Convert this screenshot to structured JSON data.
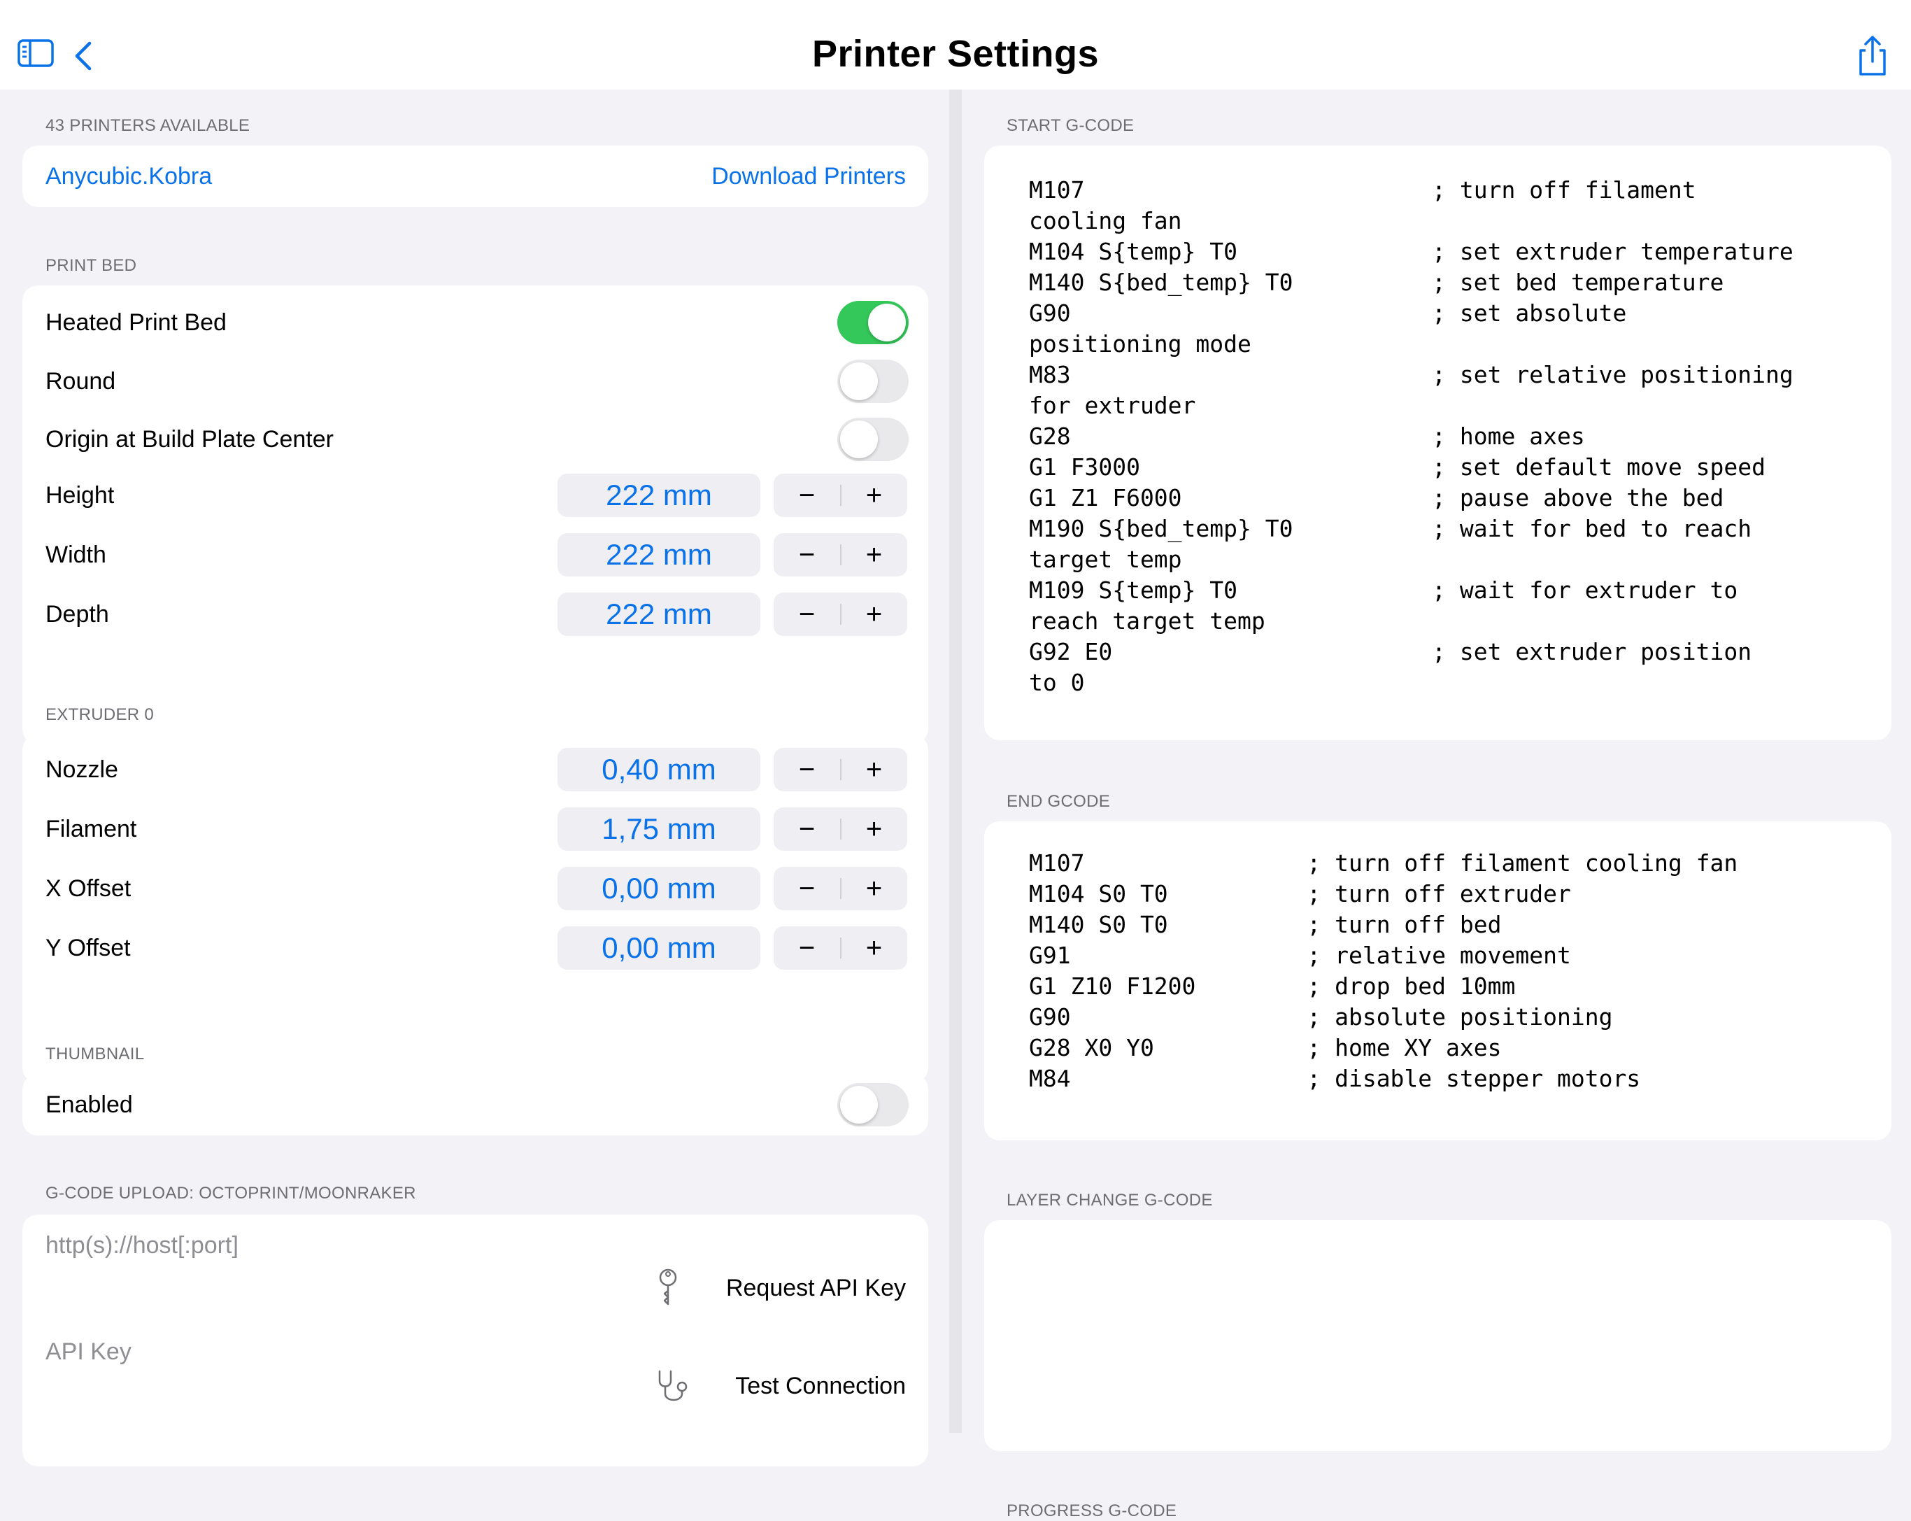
{
  "nav": {
    "title": "Printer Settings",
    "sidebar_icon": "sidebar-icon",
    "back_icon": "chevron-left-icon",
    "share_icon": "share-icon",
    "accent": "#0a72e8"
  },
  "printers": {
    "header": "43 PRINTERS AVAILABLE",
    "selected": "Anycubic.Kobra",
    "download_label": "Download Printers"
  },
  "print_bed": {
    "header": "PRINT BED",
    "heated_label": "Heated Print Bed",
    "heated_on": true,
    "round_label": "Round",
    "round_on": false,
    "origin_label": "Origin at Build Plate Center",
    "origin_on": false,
    "height_label": "Height",
    "height_value": "222 mm",
    "width_label": "Width",
    "width_value": "222 mm",
    "depth_label": "Depth",
    "depth_value": "222 mm"
  },
  "extruder": {
    "header": "EXTRUDER 0",
    "nozzle_label": "Nozzle",
    "nozzle_value": "0,40 mm",
    "filament_label": "Filament",
    "filament_value": "1,75 mm",
    "x_offset_label": "X Offset",
    "x_offset_value": "0,00 mm",
    "y_offset_label": "Y Offset",
    "y_offset_value": "0,00 mm"
  },
  "stepper": {
    "minus": "−",
    "plus": "+"
  },
  "thumbnail": {
    "header": "THUMBNAIL",
    "enabled_label": "Enabled",
    "enabled_on": false
  },
  "upload": {
    "header": "G-CODE UPLOAD: OCTOPRINT/MOONRAKER",
    "host_placeholder": "http(s)://host[:port]",
    "request_key_label": "Request API Key",
    "request_key_icon": "key-icon",
    "api_key_placeholder": "API Key",
    "test_connection_label": "Test Connection",
    "test_connection_icon": "stethoscope-icon"
  },
  "start_gcode": {
    "header": "START G-CODE",
    "code": "M107                         ; turn off filament\ncooling fan\nM104 S{temp} T0              ; set extruder temperature\nM140 S{bed_temp} T0          ; set bed temperature\nG90                          ; set absolute\npositioning mode\nM83                          ; set relative positioning\nfor extruder\nG28                          ; home axes\nG1 F3000                     ; set default move speed\nG1 Z1 F6000                  ; pause above the bed\nM190 S{bed_temp} T0          ; wait for bed to reach\ntarget temp\nM109 S{temp} T0              ; wait for extruder to\nreach target temp\nG92 E0                       ; set extruder position\nto 0"
  },
  "end_gcode": {
    "header": "END GCODE",
    "code": "M107                ; turn off filament cooling fan\nM104 S0 T0          ; turn off extruder\nM140 S0 T0          ; turn off bed\nG91                 ; relative movement\nG1 Z10 F1200        ; drop bed 10mm\nG90                 ; absolute positioning\nG28 X0 Y0           ; home XY axes\nM84                 ; disable stepper motors"
  },
  "layer_change_gcode": {
    "header": "LAYER CHANGE G-CODE",
    "code": ""
  },
  "progress_gcode": {
    "header": "PROGRESS G-CODE"
  }
}
